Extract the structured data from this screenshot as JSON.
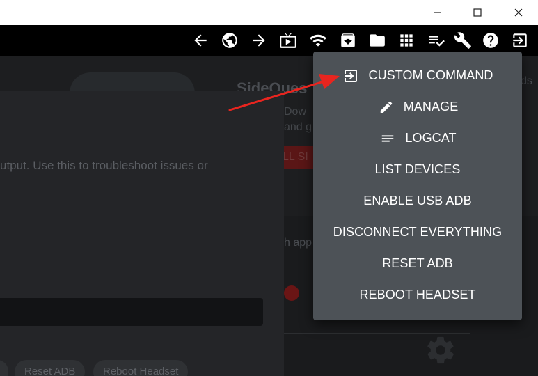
{
  "window": {
    "controls": [
      "minimize",
      "maximize",
      "close"
    ]
  },
  "toolbar": {
    "icons": [
      "arrow-left-icon",
      "globe-icon",
      "arrow-right-icon",
      "tv-icon",
      "wifi-icon",
      "archive-download-icon",
      "folder-icon",
      "apps-grid-icon",
      "playlist-check-icon",
      "wrench-icon",
      "help-icon",
      "exit-to-app-icon"
    ]
  },
  "background": {
    "hero_title": "SideQues",
    "hero_sub_1": "Dow",
    "hero_sub_2": "and g",
    "hero_button": "LL SI",
    "hero_right": "ds",
    "mid_text": "h app",
    "dialog_text": "utput. Use this to troubleshoot issues or",
    "chips": [
      "Reset ADB",
      "Reboot Headset"
    ]
  },
  "menu": {
    "items": [
      {
        "label": "CUSTOM COMMAND",
        "icon": "exit-to-app-icon"
      },
      {
        "label": "MANAGE",
        "icon": "pencil-icon"
      },
      {
        "label": "LOGCAT",
        "icon": "sort-lines-icon"
      },
      {
        "label": "LIST DEVICES",
        "icon": ""
      },
      {
        "label": "ENABLE USB ADB",
        "icon": ""
      },
      {
        "label": "DISCONNECT EVERYTHING",
        "icon": ""
      },
      {
        "label": "RESET ADB",
        "icon": ""
      },
      {
        "label": "REBOOT HEADSET",
        "icon": ""
      }
    ]
  },
  "colors": {
    "menu_bg": "#4d5257",
    "annotation_arrow": "#e8251f",
    "toolbar_bg": "#000000"
  }
}
